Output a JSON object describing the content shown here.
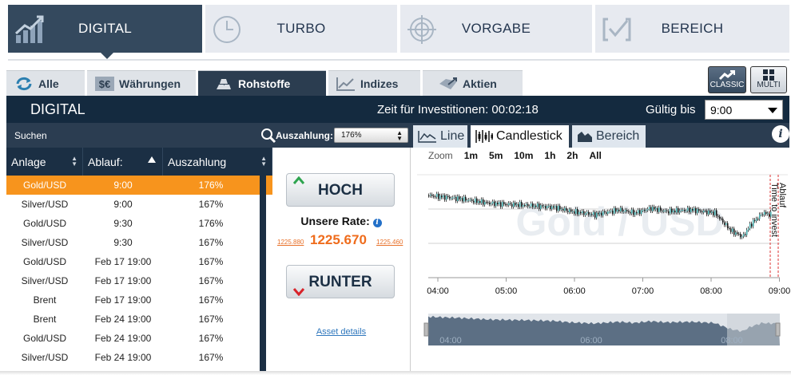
{
  "product_tabs": [
    {
      "label": "DIGITAL",
      "icon": "bar-chart-icon",
      "active": true
    },
    {
      "label": "TURBO",
      "icon": "clock-icon",
      "active": false
    },
    {
      "label": "VORGABE",
      "icon": "target-icon",
      "active": false
    },
    {
      "label": "BEREICH",
      "icon": "range-check-icon",
      "active": false
    }
  ],
  "asset_tabs": [
    {
      "label": "Alle",
      "icon": "refresh-icon"
    },
    {
      "label": "Währungen",
      "icon": "currency-icon"
    },
    {
      "label": "Rohstoffe",
      "icon": "gold-bars-icon"
    },
    {
      "label": "Indizes",
      "icon": "line-chart-icon"
    },
    {
      "label": "Aktien",
      "icon": "shares-icon"
    }
  ],
  "view_buttons": {
    "classic": "CLASSIC",
    "multi": "MULTI"
  },
  "header": {
    "title": "DIGITAL",
    "investment_time": "Zeit für Investitionen: 00:02:18",
    "valid_label": "Gültig bis",
    "valid_value": "9:00"
  },
  "filter": {
    "search": "Suchen",
    "payout_label": "Auszahlung:",
    "payout_value": "176%"
  },
  "chart_tabs": {
    "line": "Line",
    "candlestick": "Candlestick",
    "area": "Bereich"
  },
  "table": {
    "headers": [
      "Anlage",
      "Ablauf:",
      "Auszahlung"
    ],
    "rows": [
      [
        "Gold/USD",
        "9:00",
        "176%"
      ],
      [
        "Silver/USD",
        "9:00",
        "167%"
      ],
      [
        "Gold/USD",
        "9:30",
        "176%"
      ],
      [
        "Silver/USD",
        "9:30",
        "167%"
      ],
      [
        "Gold/USD",
        "Feb 17 19:00",
        "167%"
      ],
      [
        "Silver/USD",
        "Feb 17 19:00",
        "167%"
      ],
      [
        "Brent",
        "Feb 17 19:00",
        "167%"
      ],
      [
        "Brent",
        "Feb 24 19:00",
        "167%"
      ],
      [
        "Gold/USD",
        "Feb 24 19:00",
        "167%"
      ],
      [
        "Silver/USD",
        "Feb 24 19:00",
        "167%"
      ]
    ]
  },
  "trade": {
    "up": "HOCH",
    "down": "RUNTER",
    "rate_label": "Unsere Rate:",
    "rate": "1225.670",
    "low": "1225.880",
    "high": "1225.460",
    "asset_details": "Asset details"
  },
  "chart": {
    "zoom_label": "Zoom",
    "zoom_options": [
      "1m",
      "5m",
      "10m",
      "1h",
      "2h",
      "All"
    ],
    "watermark": "Gold / USD",
    "expiry_label": "Ablauf",
    "invest_label": "Time to invest",
    "x_labels": [
      "04:00",
      "05:00",
      "06:00",
      "07:00",
      "08:00",
      "09:00"
    ],
    "nav_labels": [
      "04:00",
      "06:00",
      "08:00"
    ]
  },
  "colors": {
    "accent": "#f7941d",
    "navy": "#1b2f44",
    "rate": "#ef6c1c",
    "link": "#2f77bd"
  }
}
